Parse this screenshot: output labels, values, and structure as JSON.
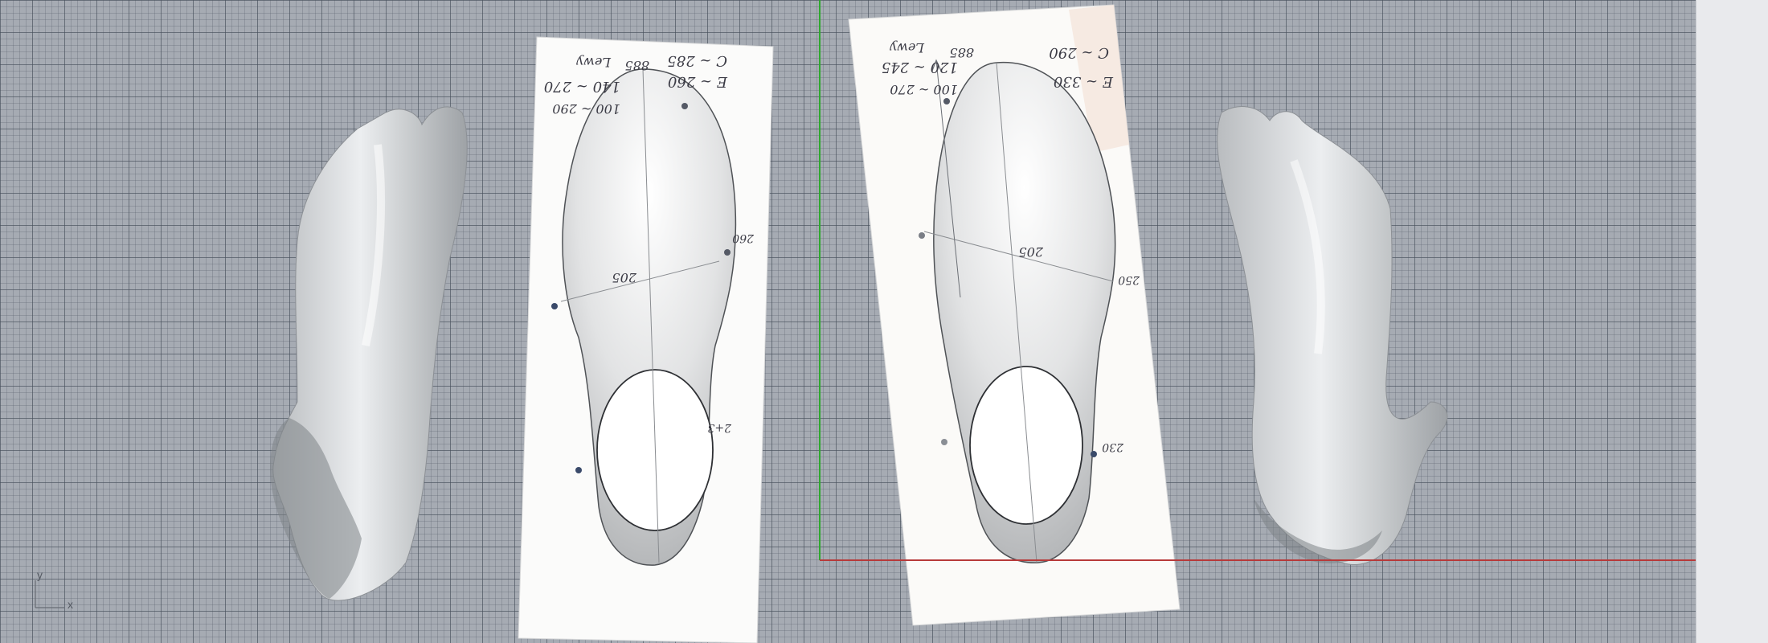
{
  "viewport": {
    "axis_labels": {
      "y": "y",
      "x": "x"
    },
    "colors": {
      "background": "#a6abb3",
      "grid_major": "#4a5260",
      "y_axis": "#2fa82f",
      "x_axis": "#b73a3a"
    }
  },
  "left_sheet": {
    "annotations": {
      "top_line1": "C ~ 285",
      "top_line2": "E ~ 260",
      "top_left1": "140 ~ 270",
      "top_left2": "100 ~ 290",
      "top_tag": "Lewy",
      "top_mark": "885",
      "mid": "205",
      "right": "260",
      "lower": "2+3"
    }
  },
  "right_sheet": {
    "annotations": {
      "top_line1": "C ~ 290",
      "top_line2": "E ~ 330",
      "top_left1": "120 ~ 245",
      "top_left2": "100 ~ 270",
      "top_tag": "Lewy",
      "top_mark": "885",
      "mid": "205",
      "right": "250",
      "lower": "230"
    }
  }
}
